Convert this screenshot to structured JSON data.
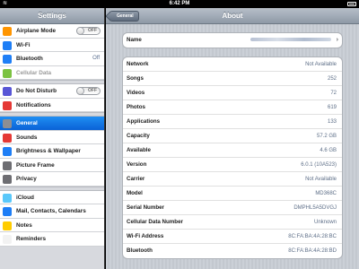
{
  "status_bar": {
    "carrier_icon": "wifi-icon",
    "time": "6:42 PM",
    "battery_icon": "battery-icon"
  },
  "left": {
    "title": "Settings",
    "groups": [
      [
        {
          "label": "Airplane Mode",
          "icon": "airplane-icon",
          "color": "#ff9500",
          "toggle": "OFF"
        },
        {
          "label": "Wi-Fi",
          "icon": "wifi-icon",
          "color": "#1e7ef6",
          "value": ""
        },
        {
          "label": "Bluetooth",
          "icon": "bluetooth-icon",
          "color": "#1e7ef6",
          "value": "Off"
        },
        {
          "label": "Cellular Data",
          "icon": "cellular-icon",
          "color": "#7cc242",
          "disabled": true
        }
      ],
      [
        {
          "label": "Do Not Disturb",
          "icon": "moon-icon",
          "color": "#5856d6",
          "toggle": "OFF"
        },
        {
          "label": "Notifications",
          "icon": "notifications-icon",
          "color": "#e53935"
        }
      ],
      [
        {
          "label": "General",
          "icon": "gear-icon",
          "color": "#8e8e93",
          "selected": true
        },
        {
          "label": "Sounds",
          "icon": "sound-icon",
          "color": "#e53935"
        },
        {
          "label": "Brightness & Wallpaper",
          "icon": "brightness-icon",
          "color": "#1e7ef6"
        },
        {
          "label": "Picture Frame",
          "icon": "picture-frame-icon",
          "color": "#6d6d72"
        },
        {
          "label": "Privacy",
          "icon": "hand-icon",
          "color": "#6d6d72"
        }
      ],
      [
        {
          "label": "iCloud",
          "icon": "cloud-icon",
          "color": "#5ac8fa"
        },
        {
          "label": "Mail, Contacts, Calendars",
          "icon": "mail-icon",
          "color": "#1e7ef6"
        },
        {
          "label": "Notes",
          "icon": "notes-icon",
          "color": "#ffcc00"
        },
        {
          "label": "Reminders",
          "icon": "reminders-icon",
          "color": "#f2f2f2"
        }
      ]
    ]
  },
  "right": {
    "title": "About",
    "back_label": "General",
    "name_row": {
      "label": "Name"
    },
    "rows": [
      {
        "label": "Network",
        "value": "Not Available"
      },
      {
        "label": "Songs",
        "value": "252"
      },
      {
        "label": "Videos",
        "value": "72"
      },
      {
        "label": "Photos",
        "value": "619"
      },
      {
        "label": "Applications",
        "value": "133"
      },
      {
        "label": "Capacity",
        "value": "57.2 GB"
      },
      {
        "label": "Available",
        "value": "4.6 GB"
      },
      {
        "label": "Version",
        "value": "6.0.1 (10A523)"
      },
      {
        "label": "Carrier",
        "value": "Not Available"
      },
      {
        "label": "Model",
        "value": "MD368C"
      },
      {
        "label": "Serial Number",
        "value": "DMPHL5A5DVGJ"
      },
      {
        "label": "Cellular Data Number",
        "value": "Unknown"
      },
      {
        "label": "Wi-Fi Address",
        "value": "8C:FA:BA:4A:28:BC"
      },
      {
        "label": "Bluetooth",
        "value": "8C:FA:BA:4A:28:BD"
      }
    ]
  }
}
